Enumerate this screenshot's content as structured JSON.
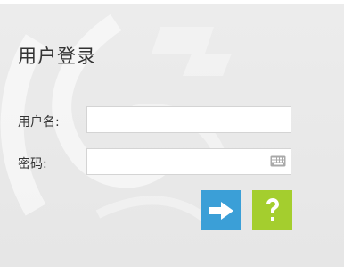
{
  "title": "用户登录",
  "username": {
    "label": "用户名:",
    "value": "",
    "placeholder": ""
  },
  "password": {
    "label": "密码:",
    "value": "",
    "placeholder": ""
  },
  "icons": {
    "keyboard": "keyboard-icon",
    "login": "arrow-right-icon",
    "help": "question-mark-icon"
  },
  "colors": {
    "login_button": "#3b9fd7",
    "help_button": "#a4ce2e",
    "background": "#e9e9e9",
    "text": "#333333"
  }
}
